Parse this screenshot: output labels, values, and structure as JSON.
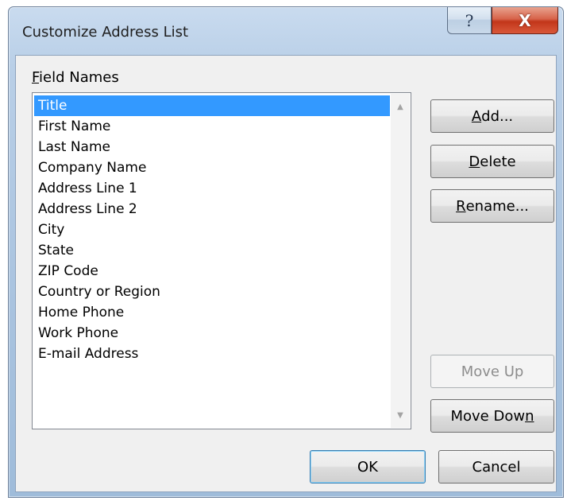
{
  "window": {
    "title": "Customize Address List",
    "help_glyph": "?",
    "close_glyph": "X"
  },
  "field_names": {
    "label_accel": "F",
    "label_rest": "ield Names",
    "items": [
      "Title",
      "First Name",
      "Last Name",
      "Company Name",
      "Address Line 1",
      "Address Line 2",
      "City",
      "State",
      "ZIP Code",
      "Country or Region",
      "Home Phone",
      "Work Phone",
      "E-mail Address"
    ],
    "selected_index": 0
  },
  "buttons": {
    "add": {
      "accel": "A",
      "rest": "dd..."
    },
    "delete": {
      "accel": "D",
      "rest": "elete"
    },
    "rename": {
      "accel": "R",
      "rest": "ename..."
    },
    "move_up": "Move Up",
    "move_down": {
      "pre": "Move Dow",
      "accel": "n"
    },
    "ok": "OK",
    "cancel": "Cancel"
  },
  "icons": {
    "help": "help-icon",
    "close": "close-icon",
    "scroll_up": "scroll-up-arrow-icon",
    "scroll_down": "scroll-down-arrow-icon"
  },
  "colors": {
    "selection": "#3399ff",
    "close_button": "#c2361a"
  }
}
